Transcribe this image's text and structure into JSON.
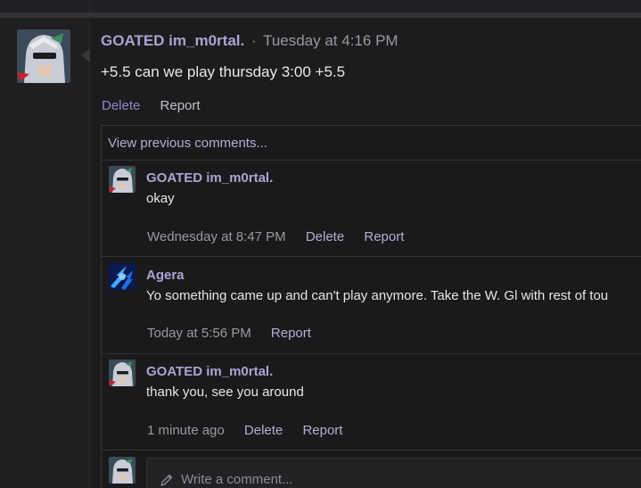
{
  "post": {
    "author": "GOATED im_m0rtal.",
    "separator": "·",
    "time": "Tuesday at 4:16 PM",
    "body": "+5.5 can we play thursday 3:00 +5.5",
    "delete_label": "Delete",
    "report_label": "Report"
  },
  "comments": {
    "view_previous": "View previous comments...",
    "items": [
      {
        "author": "GOATED im_m0rtal.",
        "text": "okay",
        "time": "Wednesday at 8:47 PM",
        "delete_label": "Delete",
        "report_label": "Report"
      },
      {
        "author": "Agera",
        "text": "Yo something came up and can't play anymore. Take the W. Gl with rest of tou",
        "time": "Today at 5:56 PM",
        "report_label": "Report"
      },
      {
        "author": "GOATED im_m0rtal.",
        "text": "thank you, see you around",
        "time": "1 minute ago",
        "delete_label": "Delete",
        "report_label": "Report"
      }
    ],
    "write_placeholder": "Write a comment..."
  },
  "colors": {
    "background": "#1c1c1e",
    "author": "#a9a3cf",
    "link": "#b3aed6",
    "delete_accent": "#8e85c8"
  },
  "icons": {
    "pencil": "pencil-icon"
  }
}
